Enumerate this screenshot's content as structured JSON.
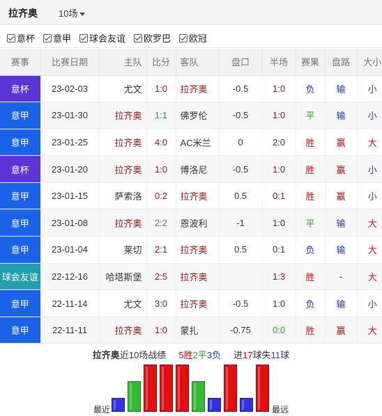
{
  "header": {
    "team": "拉齐奥",
    "count": "10场"
  },
  "filters": [
    "意杯",
    "意甲",
    "球会友谊",
    "欧罗巴",
    "欧冠"
  ],
  "table": {
    "columns": [
      "赛事",
      "比赛日期",
      "主队",
      "比分",
      "客队",
      "盘口",
      "半场",
      "赛果",
      "盘路",
      "大小"
    ],
    "rows": [
      {
        "league": "意杯",
        "lcolor": "#5b35d5",
        "date": "23-02-03",
        "home": "尤文",
        "score": "1:0",
        "away": "拉齐奥",
        "handicap": "-0.5",
        "half": "1:0",
        "result": "负",
        "path": "输",
        "ou": "小",
        "hl": "away"
      },
      {
        "league": "意甲",
        "lcolor": "#1a62e8",
        "date": "23-01-30",
        "home": "拉齐奥",
        "score": "1:1",
        "away": "佛罗伦",
        "handicap": "-0.5",
        "half": "1:0",
        "result": "平",
        "path": "输",
        "ou": "小",
        "hl": "home"
      },
      {
        "league": "意甲",
        "lcolor": "#1a62e8",
        "date": "23-01-25",
        "home": "拉齐奥",
        "score": "4:0",
        "away": "AC米兰",
        "handicap": "0",
        "half": "2:0",
        "result": "胜",
        "path": "赢",
        "ou": "大",
        "hl": "home"
      },
      {
        "league": "意杯",
        "lcolor": "#5b35d5",
        "date": "23-01-20",
        "home": "拉齐奥",
        "score": "1:0",
        "away": "博洛尼",
        "handicap": "-0.5",
        "half": "1:0",
        "result": "胜",
        "path": "赢",
        "ou": "小",
        "hl": "home"
      },
      {
        "league": "意甲",
        "lcolor": "#1a62e8",
        "date": "23-01-15",
        "home": "萨索洛",
        "score": "0:2",
        "away": "拉齐奥",
        "handicap": "0.5",
        "half": "0:1",
        "result": "胜",
        "path": "赢",
        "ou": "小",
        "hl": "away"
      },
      {
        "league": "意甲",
        "lcolor": "#1a62e8",
        "date": "23-01-08",
        "home": "拉齐奥",
        "score": "2:2",
        "away": "恩波利",
        "handicap": "-1",
        "half": "1:0",
        "result": "平",
        "path": "输",
        "ou": "大",
        "hl": "home"
      },
      {
        "league": "意甲",
        "lcolor": "#1a62e8",
        "date": "23-01-04",
        "home": "莱切",
        "score": "2:1",
        "away": "拉齐奥",
        "handicap": "0.5",
        "half": "0:1",
        "result": "负",
        "path": "输",
        "ou": "大",
        "hl": "away"
      },
      {
        "league": "球会友谊",
        "lcolor": "#22a0b0",
        "date": "22-12-16",
        "home": "哈塔斯堡",
        "score": "2:5",
        "away": "拉齐奥",
        "handicap": "",
        "half": "1:3",
        "result": "胜",
        "path": "-",
        "ou": "大",
        "hl": "away"
      },
      {
        "league": "意甲",
        "lcolor": "#1a62e8",
        "date": "22-11-14",
        "home": "尤文",
        "score": "3:0",
        "away": "拉齐奥",
        "handicap": "-0.5",
        "half": "1:0",
        "result": "负",
        "path": "输",
        "ou": "小",
        "hl": "away"
      },
      {
        "league": "意甲",
        "lcolor": "#1a62e8",
        "date": "22-11-11",
        "home": "拉齐奥",
        "score": "1:0",
        "away": "蒙扎",
        "handicap": "-0.75",
        "half": "0:0",
        "result": "胜",
        "path": "赢",
        "ou": "大",
        "hl": "home"
      }
    ]
  },
  "summary": {
    "team": "拉齐奥",
    "label": "近10场战绩",
    "wins": "5",
    "w": "胜",
    "draws": "2",
    "d": "平",
    "losses": "3",
    "l": "负",
    "scored_label": "进",
    "scored": "17",
    "ball": "球",
    "conceded_label": "失",
    "conceded": "11",
    "ball2": "球"
  },
  "chart_labels": {
    "left": "最近",
    "right": "最远"
  },
  "colors": {
    "win": "#e01010",
    "draw": "#33bb33",
    "loss": "#3333dd",
    "score": "#2a9d2a"
  },
  "chart_data": {
    "type": "bar",
    "categories": [
      "23-02-03",
      "23-01-30",
      "23-01-25",
      "23-01-20",
      "23-01-15",
      "23-01-08",
      "23-01-04",
      "22-12-16",
      "22-11-14",
      "22-11-11"
    ],
    "values": [
      1,
      2,
      3,
      3,
      3,
      2,
      1,
      3,
      1,
      3
    ],
    "results": [
      "负",
      "平",
      "胜",
      "胜",
      "胜",
      "平",
      "负",
      "胜",
      "负",
      "胜"
    ]
  }
}
